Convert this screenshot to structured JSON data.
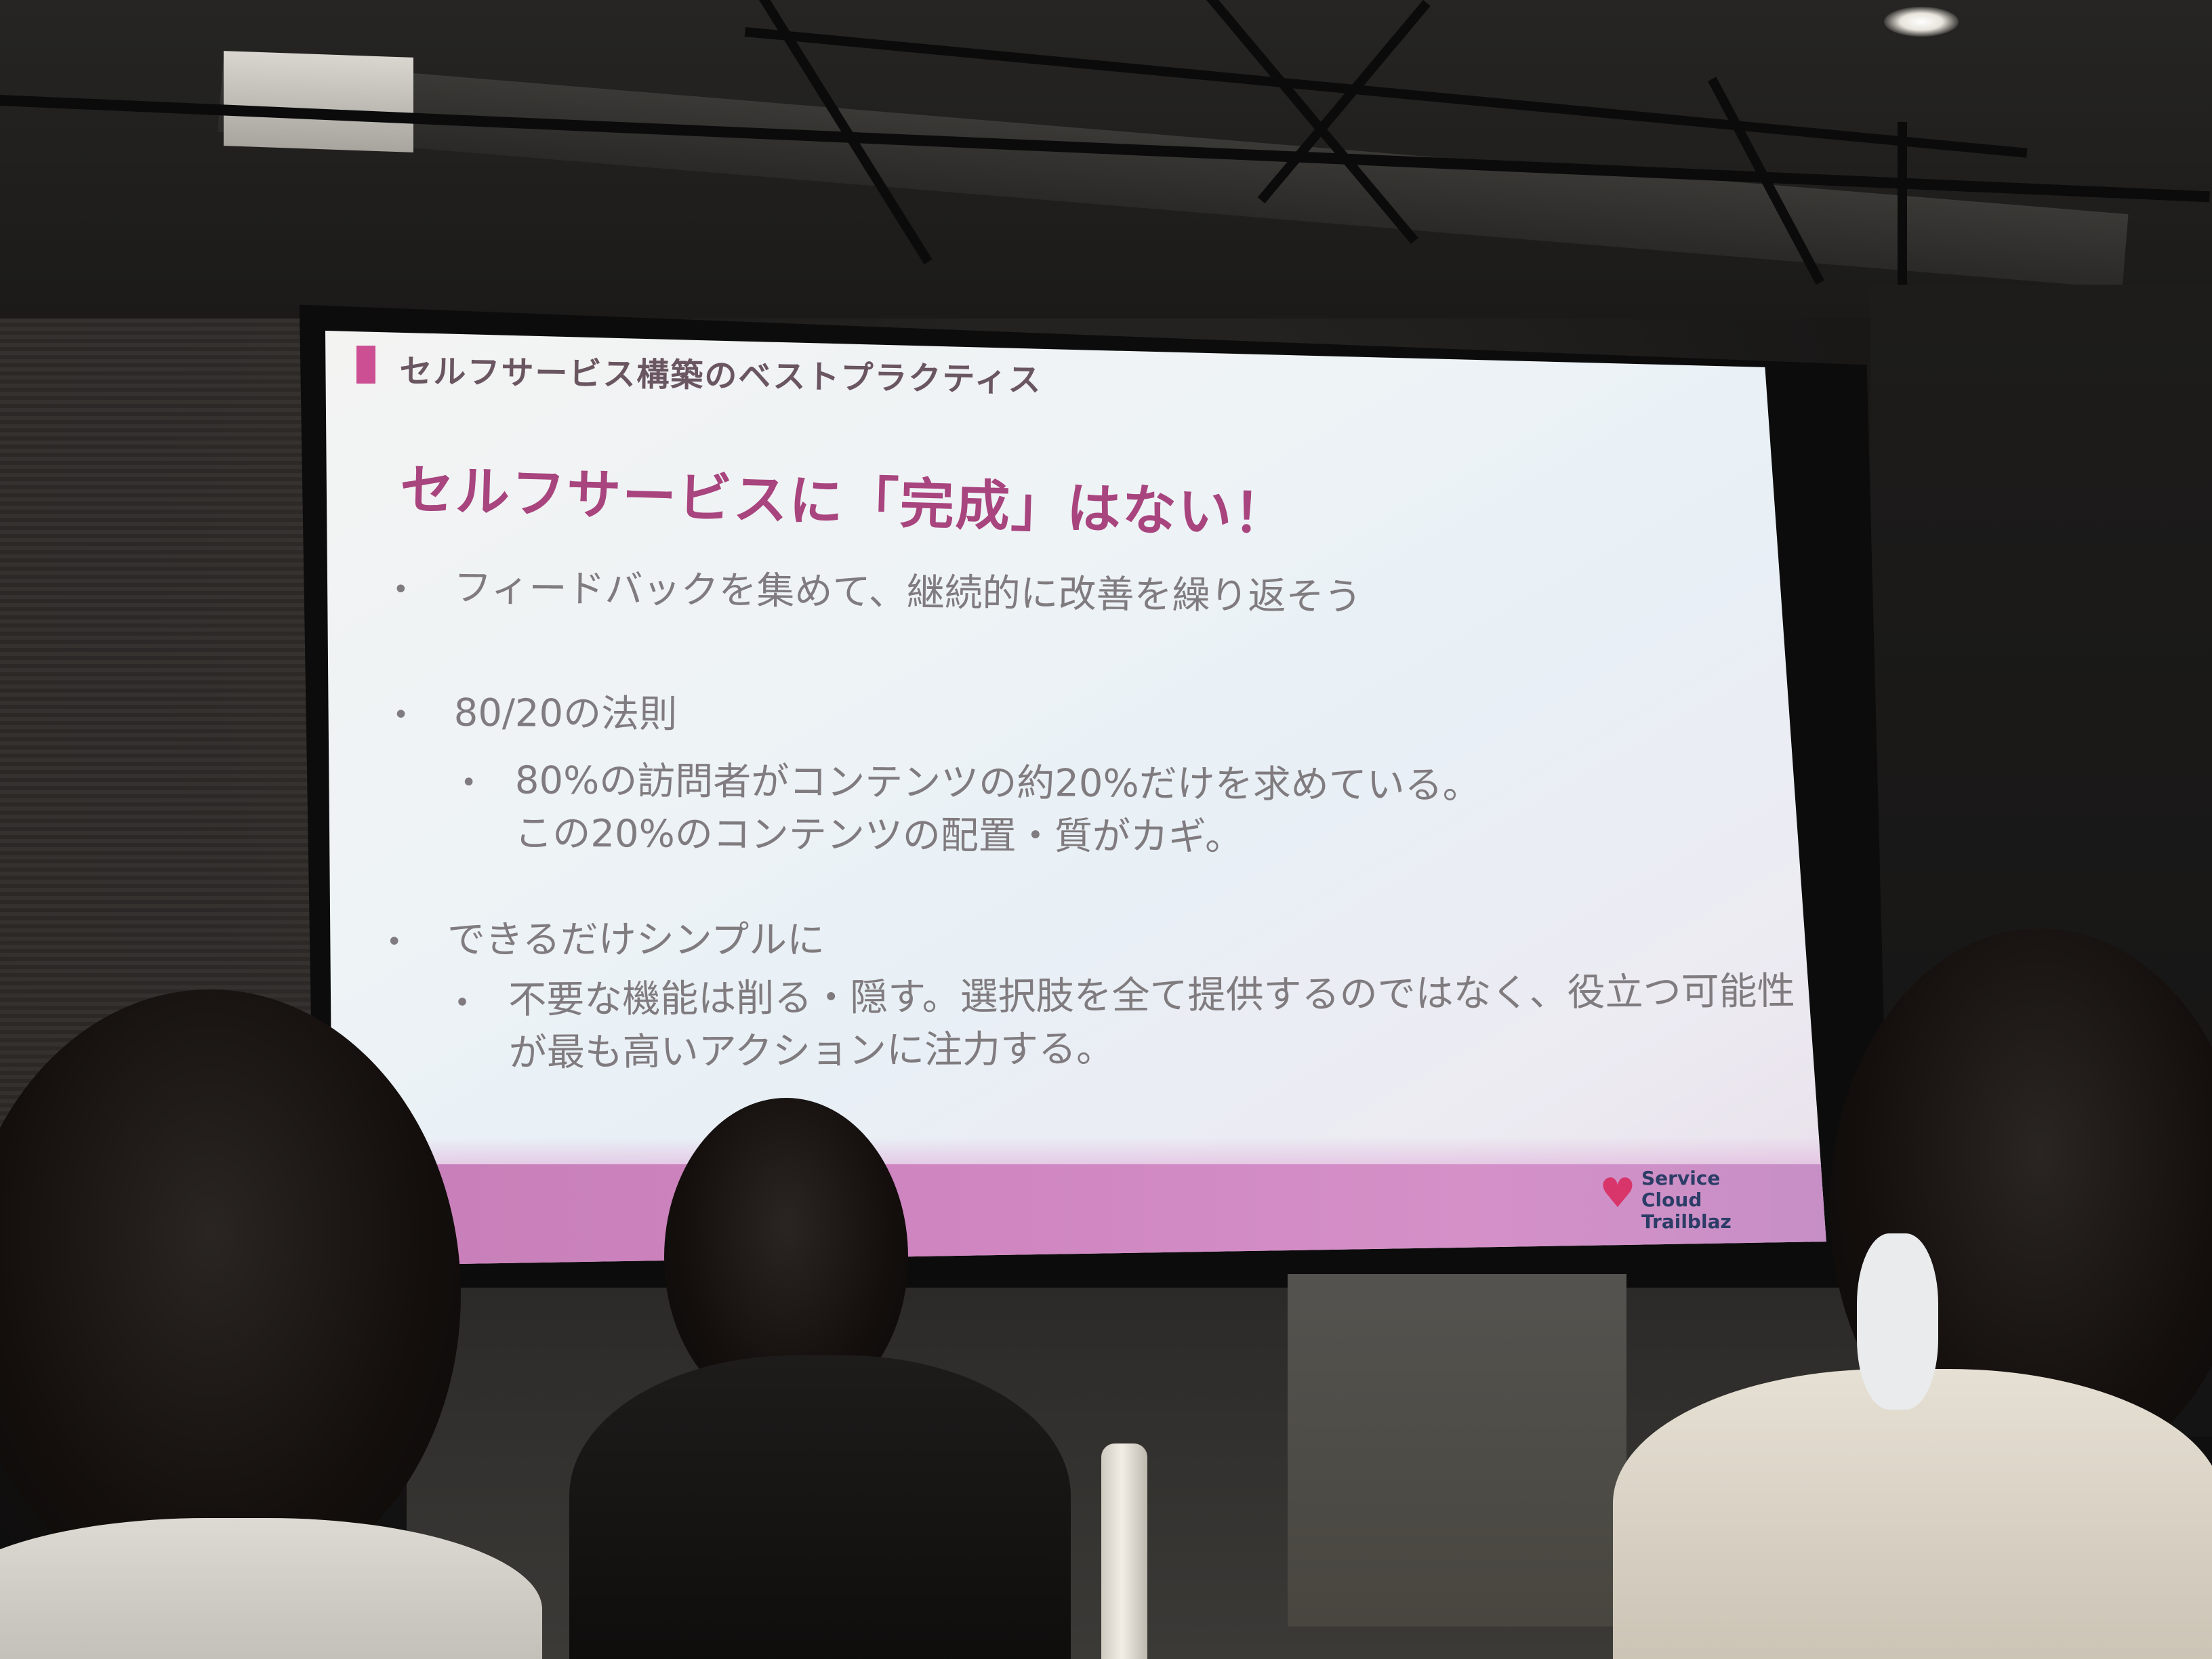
{
  "slide": {
    "header": "セルフサービス構築のベストプラクティス",
    "title": "セルフサービスに「完成」はない！",
    "bullets": [
      {
        "dot": "•",
        "text": "フィードバックを集めて、継続的に改善を繰り返そう"
      },
      {
        "dot": "•",
        "text": "80/20の法則",
        "sub": {
          "dot": "•",
          "line1": "80%の訪問者がコンテンツの約20%だけを求めている。",
          "line2": "この20%のコンテンツの配置・質がカギ。"
        }
      },
      {
        "dot": "•",
        "text": "できるだけシンプルに",
        "sub": {
          "dot": "•",
          "line1": "不要な機能は削る・隠す。選択肢を全て提供するのではなく、役立つ可能性",
          "line2": "が最も高いアクションに注力する。"
        }
      }
    ],
    "logo": {
      "icon": "heart-mountain-icon",
      "line1": "Service",
      "line2": "Cloud",
      "line3": "Trailblaz"
    }
  },
  "colors": {
    "accent": "#cc4f93",
    "title": "#a8447e",
    "body_text": "#807b7e",
    "bottom_band": "#cf85c0"
  }
}
